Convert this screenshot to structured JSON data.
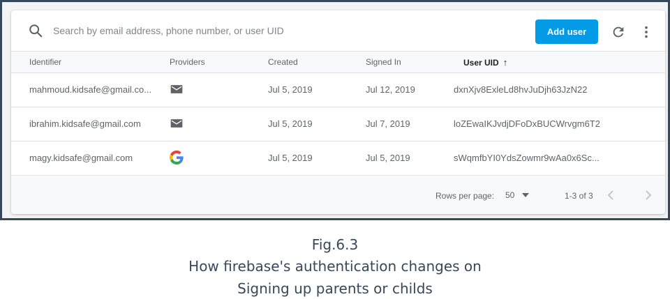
{
  "search": {
    "placeholder": "Search by email address, phone number, or user UID"
  },
  "toolbar": {
    "add_user_label": "Add user"
  },
  "columns": {
    "identifier": "Identifier",
    "providers": "Providers",
    "created": "Created",
    "signed_in": "Signed In",
    "user_uid": "User UID"
  },
  "rows": [
    {
      "identifier": "mahmoud.kidsafe@gmail.co...",
      "provider": "email-icon",
      "created": "Jul 5, 2019",
      "signed_in": "Jul 12, 2019",
      "uid": "dxnXjv8ExleLd8hvJuDjh63JzN22"
    },
    {
      "identifier": "ibrahim.kidsafe@gmail.com",
      "provider": "email-icon",
      "created": "Jul 5, 2019",
      "signed_in": "Jul 7, 2019",
      "uid": "loZEwaIKJvdjDFoDxBUCWrvgm6T2"
    },
    {
      "identifier": "magy.kidsafe@gmail.com",
      "provider": "google-icon",
      "created": "Jul 5, 2019",
      "signed_in": "Jul 5, 2019",
      "uid": "sWqmfbYI0YdsZowmr9wAa0x6Sc..."
    }
  ],
  "pagination": {
    "rows_per_page_label": "Rows per page:",
    "rows_per_page_value": "50",
    "range": "1-3 of 3"
  },
  "caption": {
    "figure": "Fig.6.3",
    "line1": "How firebase's authentication changes on",
    "line2": "Signing up parents or childs"
  },
  "colors": {
    "accent": "#039be5",
    "frame": "#37485a",
    "google_red": "#ea4335",
    "google_blue": "#4285f4",
    "google_yellow": "#fbbc05",
    "google_green": "#34a853"
  }
}
